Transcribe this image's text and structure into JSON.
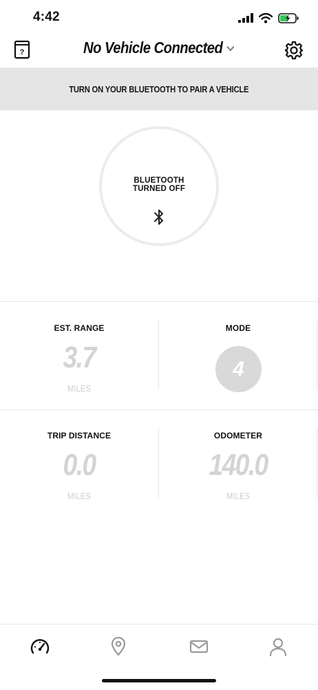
{
  "status_bar": {
    "time": "4:42"
  },
  "header": {
    "title": "No Vehicle Connected",
    "help_icon": "question-book-icon",
    "dropdown_icon": "chevron-down-icon",
    "settings_icon": "gear-icon"
  },
  "banner": {
    "text": "TURN ON YOUR BLUETOOTH TO PAIR A VEHICLE"
  },
  "bluetooth": {
    "status": "BLUETOOTH\nTURNED OFF",
    "icon": "bluetooth-icon"
  },
  "stats": {
    "est_range": {
      "label": "EST. RANGE",
      "value": "3.7",
      "unit": "MILES"
    },
    "mode": {
      "label": "MODE",
      "value": "4"
    },
    "trip_distance": {
      "label": "TRIP DISTANCE",
      "value": "0.0",
      "unit": "MILES"
    },
    "odometer": {
      "label": "ODOMETER",
      "value": "140.0",
      "unit": "MILES"
    }
  },
  "tabs": [
    {
      "icon": "speedometer-icon",
      "active": true
    },
    {
      "icon": "location-pin-icon",
      "active": false
    },
    {
      "icon": "mail-icon",
      "active": false
    },
    {
      "icon": "profile-icon",
      "active": false
    }
  ],
  "colors": {
    "banner_bg": "#e5e5e5",
    "value_gray": "#d4d4d4",
    "inactive_icon": "#9a9a9a",
    "active_icon": "#111111"
  }
}
